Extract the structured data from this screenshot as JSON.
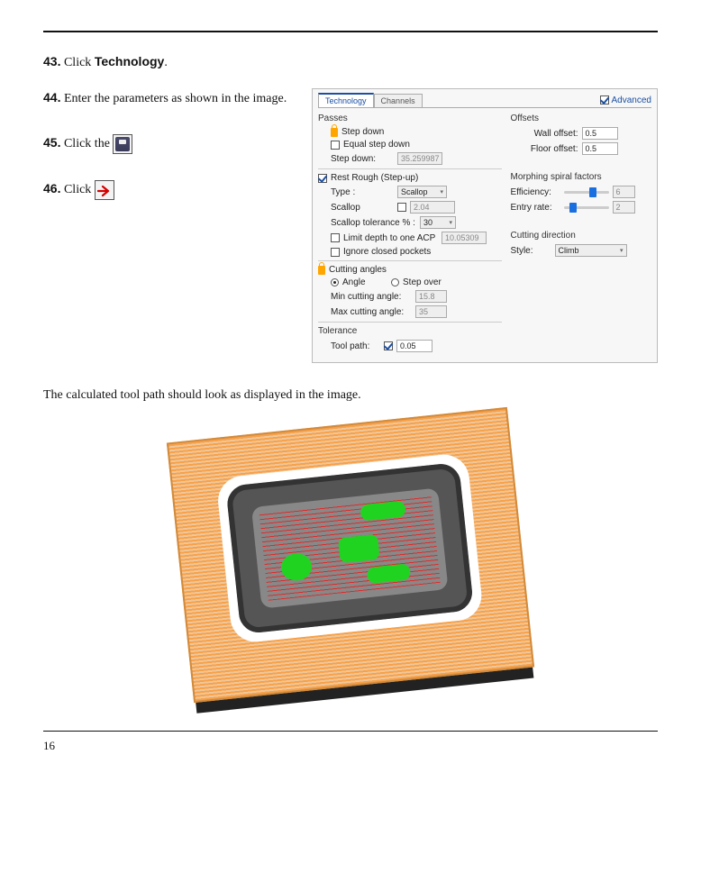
{
  "steps": {
    "s43": {
      "num": "43.",
      "pre": "Click ",
      "bold": "Technology",
      "post": "."
    },
    "s44": {
      "num": "44.",
      "text": "Enter the parameters as shown in the image."
    },
    "s45": {
      "num": "45.",
      "text": "Click the "
    },
    "s46": {
      "num": "46.",
      "text": "Click "
    }
  },
  "dialog": {
    "tabs": {
      "active": "Technology",
      "other": "Channels"
    },
    "advanced": "Advanced",
    "passes": {
      "title": "Passes",
      "step_down_chk": "Step down",
      "equal_step_down": "Equal step down",
      "step_down_label": "Step down:",
      "step_down_val": "35.259987"
    },
    "rest_rough": {
      "title": "Rest Rough (Step-up)",
      "type_label": "Type :",
      "type_val": "Scallop",
      "scallop_label": "Scallop",
      "scallop_val": "2.04",
      "scallop_tol_label": "Scallop tolerance % :",
      "scallop_tol_val": "30",
      "limit_acp": "Limit depth to one ACP",
      "limit_acp_val": "10.05309",
      "ignore_pockets": "Ignore closed pockets"
    },
    "cutting_angles": {
      "title": "Cutting angles",
      "angle": "Angle",
      "step_over": "Step over",
      "min_label": "Min cutting angle:",
      "min_val": "15.8",
      "max_label": "Max cutting angle:",
      "max_val": "35"
    },
    "tolerance": {
      "title": "Tolerance",
      "label": "Tool path:",
      "val": "0.05"
    },
    "offsets": {
      "title": "Offsets",
      "wall_label": "Wall offset:",
      "wall_val": "0.5",
      "floor_label": "Floor offset:",
      "floor_val": "0.5"
    },
    "morphing": {
      "title": "Morphing spiral factors",
      "eff_label": "Efficiency:",
      "eff_val": "6",
      "entry_label": "Entry rate:",
      "entry_val": "2"
    },
    "cutting_dir": {
      "title": "Cutting direction",
      "style_label": "Style:",
      "style_val": "Climb"
    }
  },
  "below_text": "The calculated tool path should look as displayed in the image.",
  "page_number": "16"
}
